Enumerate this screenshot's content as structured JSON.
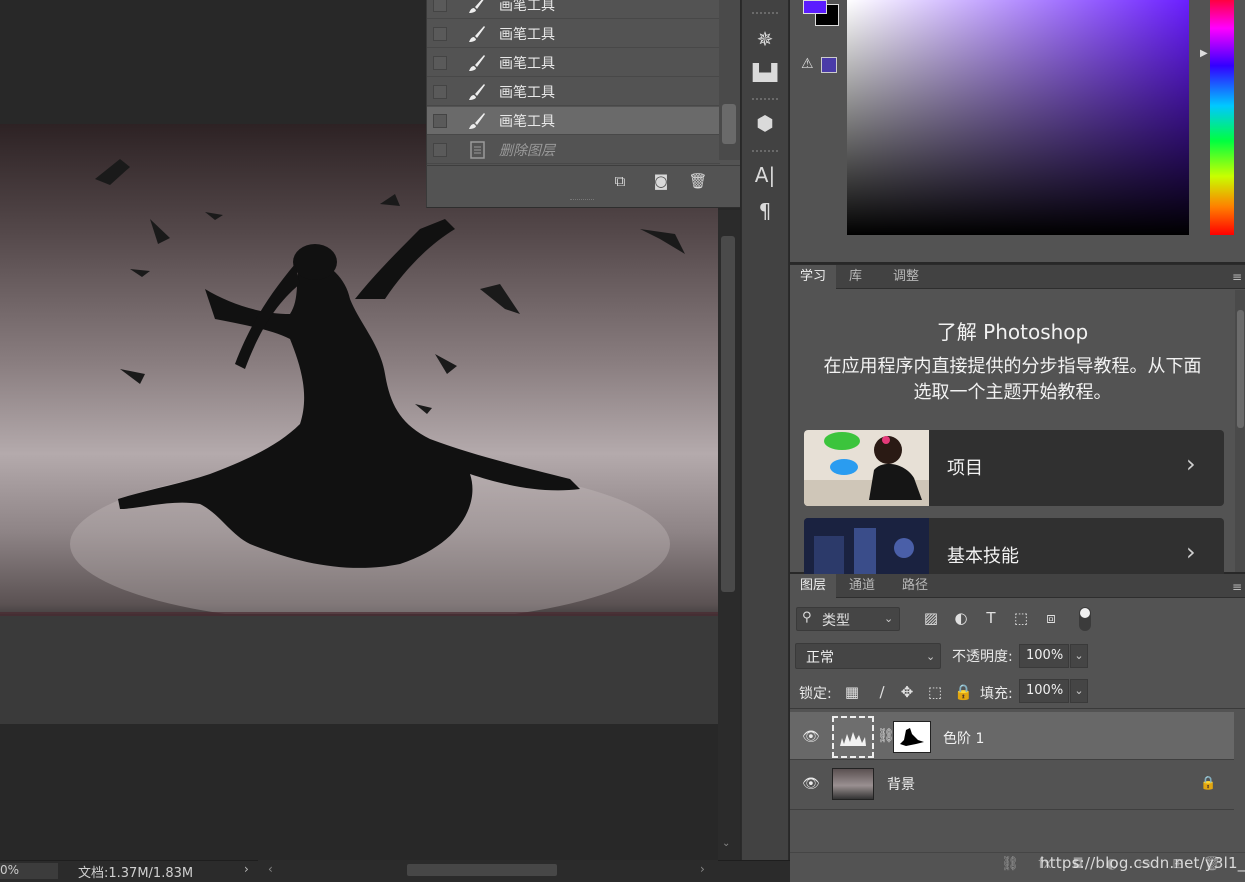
{
  "history": {
    "items": [
      {
        "label": "画笔工具",
        "icon": "brush-icon",
        "selected": false
      },
      {
        "label": "画笔工具",
        "icon": "brush-icon",
        "selected": false
      },
      {
        "label": "画笔工具",
        "icon": "brush-icon",
        "selected": false
      },
      {
        "label": "画笔工具",
        "icon": "brush-icon",
        "selected": false
      },
      {
        "label": "画笔工具",
        "icon": "brush-icon",
        "selected": true
      },
      {
        "label": "删除图层",
        "icon": "document-icon",
        "selected": false
      }
    ],
    "toolbar": [
      "new-document-from-state-icon",
      "snapshot-camera-icon",
      "trash-icon"
    ]
  },
  "colors": {
    "foreground": "#5b1cff",
    "background": "#000000",
    "gamut_warning": "#4a3ba8"
  },
  "learn": {
    "tabs": [
      "学习",
      "库",
      "调整"
    ],
    "title": "了解 Photoshop",
    "description": "在应用程序内直接提供的分步指导教程。从下面选取一个主题开始教程。",
    "cards": [
      {
        "label": "项目"
      },
      {
        "label": "基本技能"
      }
    ]
  },
  "layers": {
    "tabs": [
      "图层",
      "通道",
      "路径"
    ],
    "filter_label": "类型",
    "blend_mode": "正常",
    "opacity_label": "不透明度:",
    "opacity_value": "100%",
    "lock_label": "锁定:",
    "fill_label": "填充:",
    "fill_value": "100%",
    "rows": [
      {
        "name": "色阶 1",
        "selected": true
      },
      {
        "name": "背景",
        "selected": false
      }
    ]
  },
  "status": {
    "zoom": "0%",
    "doc_info": "文档:1.37M/1.83M"
  },
  "watermark": "https://blog.csdn.net/y3l1_"
}
